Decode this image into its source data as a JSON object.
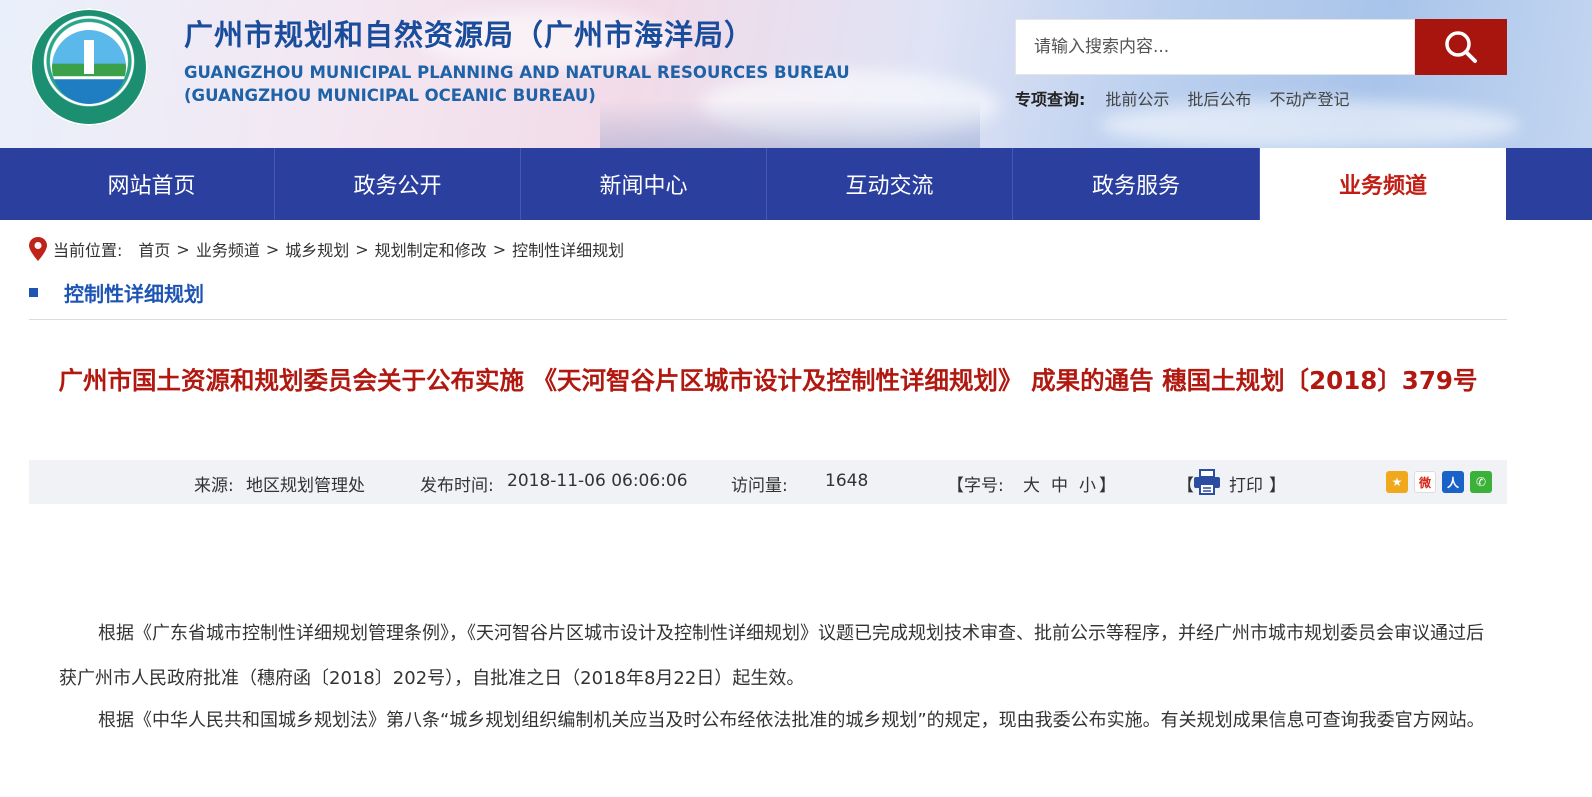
{
  "header": {
    "title_cn": "广州市规划和自然资源局（广州市海洋局）",
    "title_en_line1": "GUANGZHOU MUNICIPAL PLANNING AND NATURAL RESOURCES BUREAU",
    "title_en_line2": "(GUANGZHOU MUNICIPAL OCEANIC BUREAU)",
    "search_placeholder": "请输入搜索内容...",
    "special_label": "专项查询:",
    "special_links": [
      "批前公示",
      "批后公布",
      "不动产登记"
    ]
  },
  "nav": {
    "items": [
      "网站首页",
      "政务公开",
      "新闻中心",
      "互动交流",
      "政务服务",
      "业务频道"
    ],
    "active": "业务频道"
  },
  "breadcrumb": {
    "label": "当前位置:",
    "items": [
      "首页",
      "业务频道",
      "城乡规划",
      "规划制定和修改",
      "控制性详细规划"
    ],
    "separator": ">"
  },
  "section": {
    "title": "控制性详细规划"
  },
  "article": {
    "title": "广州市国土资源和规划委员会关于公布实施 《天河智谷片区城市设计及控制性详细规划》 成果的通告 穗国土规划〔2018〕379号",
    "source_label": "来源:",
    "source": "地区规划管理处",
    "publish_label": "发布时间:",
    "publish_time": "2018-11-06 06:06:06",
    "views_label": "访问量:",
    "views": "1648",
    "font_open": "【字号:",
    "font_sizes": [
      "大",
      "中",
      "小"
    ],
    "font_close": "】",
    "print_open": "【",
    "print_label": "打印",
    "print_close": "】",
    "paragraphs": [
      "根据《广东省城市控制性详细规划管理条例》，《天河智谷片区城市设计及控制性详细规划》议题已完成规划技术审查、批前公示等程序，并经广州市城市规划委员会审议通过后获广州市人民政府批准（穗府函〔2018〕202号），自批准之日（2018年8月22日）起生效。",
      "根据《中华人民共和国城乡规划法》第八条“城乡规划组织编制机关应当及时公布经依法批准的城乡规划”的规定，现由我委公布实施。有关规划成果信息可查询我委官方网站。"
    ]
  },
  "colors": {
    "nav_bg": "#2b3f9f",
    "active_text": "#c01e14",
    "title_red": "#b01810",
    "brand_blue": "#1a4c9c",
    "search_btn": "#a8150f"
  },
  "icons": [
    "search-icon",
    "location-pin-icon",
    "print-icon",
    "qzone-share-icon",
    "weibo-share-icon",
    "renren-share-icon",
    "wechat-share-icon"
  ]
}
